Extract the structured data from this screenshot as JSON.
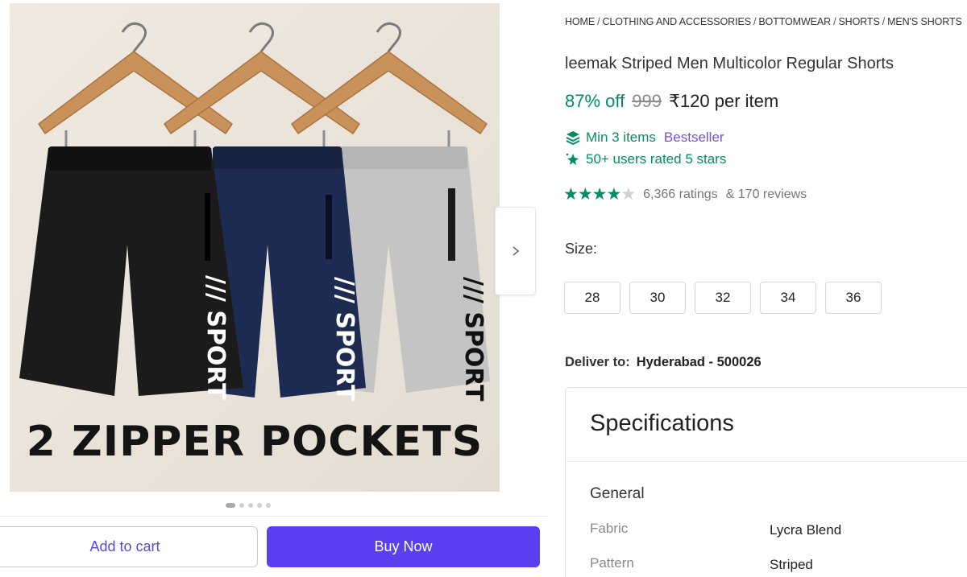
{
  "gallery": {
    "caption": "2 ZIPPER POCKETS",
    "shorts_print": "SPORT",
    "dots_count": 5,
    "active_dot": 0,
    "next_icon": "chevron-right-icon"
  },
  "actions": {
    "add_to_cart": "Add to cart",
    "buy_now": "Buy Now"
  },
  "breadcrumb": [
    "HOME",
    "CLOTHING AND ACCESSORIES",
    "BOTTOMWEAR",
    "SHORTS",
    "MEN'S SHORTS"
  ],
  "product": {
    "title": "leemak Striped Men Multicolor Regular Shorts",
    "discount": "87% off",
    "mrp": "999",
    "price": "₹120 per item",
    "min_items": "Min 3 items",
    "bestseller": "Bestseller",
    "users_rated": "50+ users rated 5 stars",
    "rating_stars": 4,
    "ratings": "6,366 ratings",
    "reviews": "& 170 reviews"
  },
  "size": {
    "label": "Size:",
    "options": [
      "28",
      "30",
      "32",
      "34",
      "36"
    ]
  },
  "delivery": {
    "label": "Deliver to:",
    "location": "Hyderabad - 500026"
  },
  "specifications": {
    "title": "Specifications",
    "group": "General",
    "rows": [
      {
        "key": "Fabric",
        "value": "Lycra Blend"
      },
      {
        "key": "Pattern",
        "value": "Striped"
      }
    ]
  },
  "colors": {
    "accent": "#5a3ff0",
    "discount_green": "#038d63",
    "bestseller_purple": "#7b4fd6",
    "short_black": "#1b1b1b",
    "short_navy": "#1d2b52",
    "short_grey": "#c4c4c4"
  }
}
